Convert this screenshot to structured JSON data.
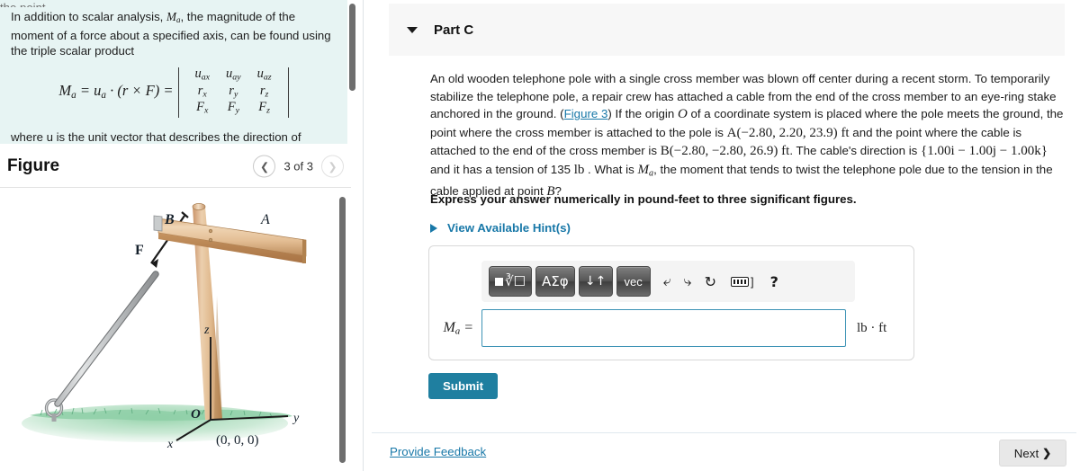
{
  "left": {
    "intro": {
      "clipped_top_line": "the point.",
      "paragraph_pre": "In addition to scalar analysis, ",
      "symbol_Ma": "M",
      "symbol_Ma_sub": "a",
      "paragraph_post": ", the magnitude of the moment of a force about a specified axis, can be found using the triple scalar product",
      "formula_lhs": "M",
      "formula_lhs_sub": "a",
      "formula_mid": " = u",
      "formula_mid_sub": "a",
      "formula_rest": " · (r × F) =",
      "matrix": [
        [
          "u",
          "a",
          "x",
          "u",
          "a",
          "y",
          "u",
          "a",
          "z"
        ],
        [
          "r",
          "x",
          "r",
          "y",
          "r",
          "z"
        ],
        [
          "F",
          "x",
          "F",
          "y",
          "F",
          "z"
        ]
      ],
      "matrix_rows": [
        {
          "c1": "u",
          "c1s": "ax",
          "c2": "u",
          "c2s": "ay",
          "c3": "u",
          "c3s": "az"
        },
        {
          "c1": "r",
          "c1s": "x",
          "c2": "r",
          "c2s": "y",
          "c3": "r",
          "c3s": "z"
        },
        {
          "c1": "F",
          "c1s": "x",
          "c2": "F",
          "c2s": "y",
          "c3": "F",
          "c3s": "z"
        }
      ],
      "where_line": "where u  is the unit vector that describes the direction of",
      "background_color": "#e7f4f3"
    },
    "figure": {
      "title": "Figure",
      "counter": "3 of 3",
      "prev_icon": "chevron-left-icon",
      "next_icon": "chevron-right-icon",
      "labels": {
        "point_A": "A",
        "point_B": "B",
        "force_F": "F",
        "axis_z": "z",
        "axis_y": "y",
        "axis_x": "x",
        "origin_O": "O",
        "origin_coords": "(0, 0, 0)"
      },
      "colors": {
        "wood_light": "#e7c49a",
        "wood_mid": "#d2a778",
        "wood_dark": "#b9895a",
        "grass": "#7ec49a",
        "cable": "#b9bcbd"
      }
    }
  },
  "right": {
    "part": {
      "label": "Part C",
      "caret_icon": "caret-down-icon",
      "collapsed": false,
      "header_bg": "#f7f7f7"
    },
    "question": {
      "s1": "An old wooden telephone pole with a single cross member was blown off center during a recent storm. To temporarily stabilize the telephone pole, a repair crew has attached a cable from the end of the cross member to an eye-ring stake anchored in the ground. (",
      "figure_link": "Figure 3",
      "s2": ") If the origin ",
      "origin_symbol": "O",
      "s3": " of a coordinate system is placed where the pole meets the ground, the point where the cross member is attached to the pole is ",
      "point_A": "A(−2.80, 2.20, 23.9)",
      "unit_ft": " ft",
      "s4": " and the point where the cable is attached to the end of the cross member is ",
      "point_B": "B(−2.80, −2.80, 26.9)",
      "s5": ". The cable's direction is ",
      "direction": "{1.00i − 1.00j − 1.00k}",
      "s6": " and it has a tension of 135 ",
      "tension_unit": "lb",
      "s7": " . What is ",
      "ma_symbol": "M",
      "ma_sub": "a",
      "s8": ", the moment that tends to twist the telephone pole due to the tension in the cable applied at point ",
      "point_b_ref": "B",
      "s9": "?"
    },
    "express_instruction": "Express your answer numerically in pound-feet to three significant figures.",
    "hints": {
      "label": "View Available Hint(s)",
      "caret_icon": "caret-right-icon"
    },
    "answer": {
      "label_main": "M",
      "label_sub": "a",
      "label_eq": " =",
      "value": "",
      "placeholder": "",
      "units": "lb · ft",
      "toolbar": {
        "buttons": [
          {
            "name": "template-root-button",
            "label": "√"
          },
          {
            "name": "greek-symbols-button",
            "label": "ΑΣφ"
          },
          {
            "name": "arrows-button",
            "label": "↓↑"
          },
          {
            "name": "vector-button",
            "label": "vec"
          }
        ],
        "icons": [
          {
            "name": "undo-icon",
            "glyph": "↰"
          },
          {
            "name": "redo-icon",
            "glyph": "↱"
          },
          {
            "name": "reset-icon",
            "glyph": "↻"
          },
          {
            "name": "keyboard-icon",
            "glyph": "⌨"
          },
          {
            "name": "help-icon",
            "glyph": "?"
          }
        ],
        "keyboard_bracket": "]"
      }
    },
    "submit_label": "Submit",
    "feedback_label": "Provide Feedback",
    "next_label": "Next",
    "next_chevron": "❯",
    "accent_color": "#1878a8",
    "submit_color": "#1f7fa0"
  }
}
